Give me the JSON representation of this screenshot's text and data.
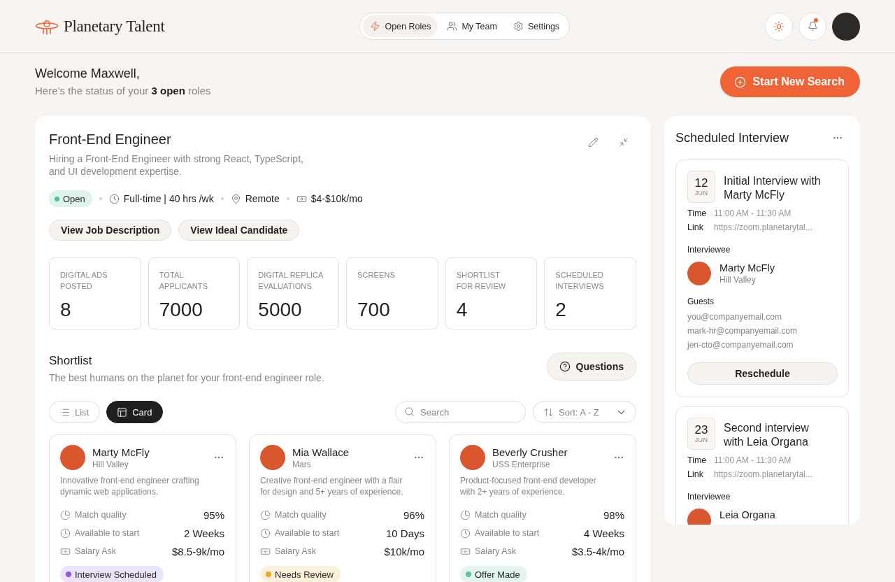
{
  "header": {
    "brand": "Planetary Talent",
    "nav": [
      {
        "label": "Open Roles",
        "selected": true
      },
      {
        "label": "My Team",
        "selected": false
      },
      {
        "label": "Settings",
        "selected": false
      }
    ],
    "unread_notifications": true
  },
  "welcome": {
    "greeting": "Welcome Maxwell,",
    "status": "Here’s the status of your **3 open** roles",
    "action": "Start New Search"
  },
  "role": {
    "title": "Front-End Engineer",
    "description": "Hiring a Front-End Engineer with strong React, TypeScript, and UI development expertise.",
    "status": "Open",
    "details": [
      "Full-time | 40 hrs /wk",
      "Remote",
      "$4-$10k/mo"
    ],
    "buttons": [
      "View Job Description",
      "View Ideal Candidate"
    ],
    "stats": [
      {
        "label": "DIGITAL ADS\nPOSTED",
        "value": "8"
      },
      {
        "label": "TOTAL\nAPPLICANTS",
        "value": "7000"
      },
      {
        "label": "DIGITAL REPLICA\nEVALUATIONS",
        "value": "5000"
      },
      {
        "label": "SCREENS",
        "value": "700"
      },
      {
        "label": "SHORTLIST\nFOR REVIEW",
        "value": "4"
      },
      {
        "label": "SCHEDULED\nINTERVIEWS",
        "value": "2"
      }
    ]
  },
  "shortlist": {
    "title": "Shortlist",
    "description": "The best humans on the planet for your front-end engineer role.",
    "questions": "Questions",
    "views": [
      {
        "label": "List",
        "selected": false
      },
      {
        "label": "Card",
        "selected": true
      }
    ],
    "search": {
      "placeholder": "Search"
    },
    "sort": "Sort: A - Z",
    "candidates": [
      {
        "name": "Marty McFly",
        "location": "Hill Valley",
        "bio": "Innovative front-end engineer crafting dynamic web applications.",
        "facts": [
          {
            "label": "Match quality",
            "value": "95%"
          },
          {
            "label": "Available to start",
            "value": "2 Weeks"
          },
          {
            "label": "Salary Ask",
            "value": "$8.5-9k/mo"
          }
        ],
        "status": {
          "label": "Interview Scheduled",
          "color": "#8a5cd6"
        }
      },
      {
        "name": "Mia Wallace",
        "location": "Mars",
        "bio": "Creative front-end engineer with a flair for design and 5+ years of experience.",
        "facts": [
          {
            "label": "Match quality",
            "value": "96%"
          },
          {
            "label": "Available to start",
            "value": "10 Days"
          },
          {
            "label": "Salary Ask",
            "value": "$10k/mo"
          }
        ],
        "status": {
          "label": "Needs Review",
          "color": "#f5a623"
        }
      },
      {
        "name": "Beverly Crusher",
        "location": "USS Enterprise",
        "bio": "Product-focused front-end developer with 2+ years of experience.",
        "facts": [
          {
            "label": "Match quality",
            "value": "98%"
          },
          {
            "label": "Available to start",
            "value": "4 Weeks"
          },
          {
            "label": "Salary Ask",
            "value": "$3.5-4k/mo"
          }
        ],
        "status": {
          "label": "Offer Made",
          "color": "#5cc4a2"
        }
      }
    ]
  },
  "interviews": {
    "title": "Scheduled Interview",
    "items": [
      {
        "day": "12",
        "month": "JUN",
        "title": "Initial Interview with Marty McFly",
        "details": [
          {
            "label": "Time",
            "value": "11:00 AM - 11:30 AM"
          },
          {
            "label": "Link",
            "value": "https://zoom.planetarytal..."
          }
        ],
        "interviewee_label": "Interviewee",
        "interviewee": {
          "name": "Marty McFly",
          "location": "Hill Valley"
        },
        "guests_label": "Guests",
        "guests": [
          "you@companyemail.com",
          "mark-hr@companyemail.com",
          "jen-cto@companyemail.com"
        ],
        "action": "Reschedule"
      },
      {
        "day": "23",
        "month": "JUN",
        "title": "Second interview with Leia Organa",
        "details": [
          {
            "label": "Time",
            "value": "11:00 AM - 11:30 AM"
          },
          {
            "label": "Link",
            "value": "https://zoom.planetarytal..."
          }
        ],
        "interviewee_label": "Interviewee",
        "interviewee": {
          "name": "Leia Organa"
        }
      }
    ]
  }
}
